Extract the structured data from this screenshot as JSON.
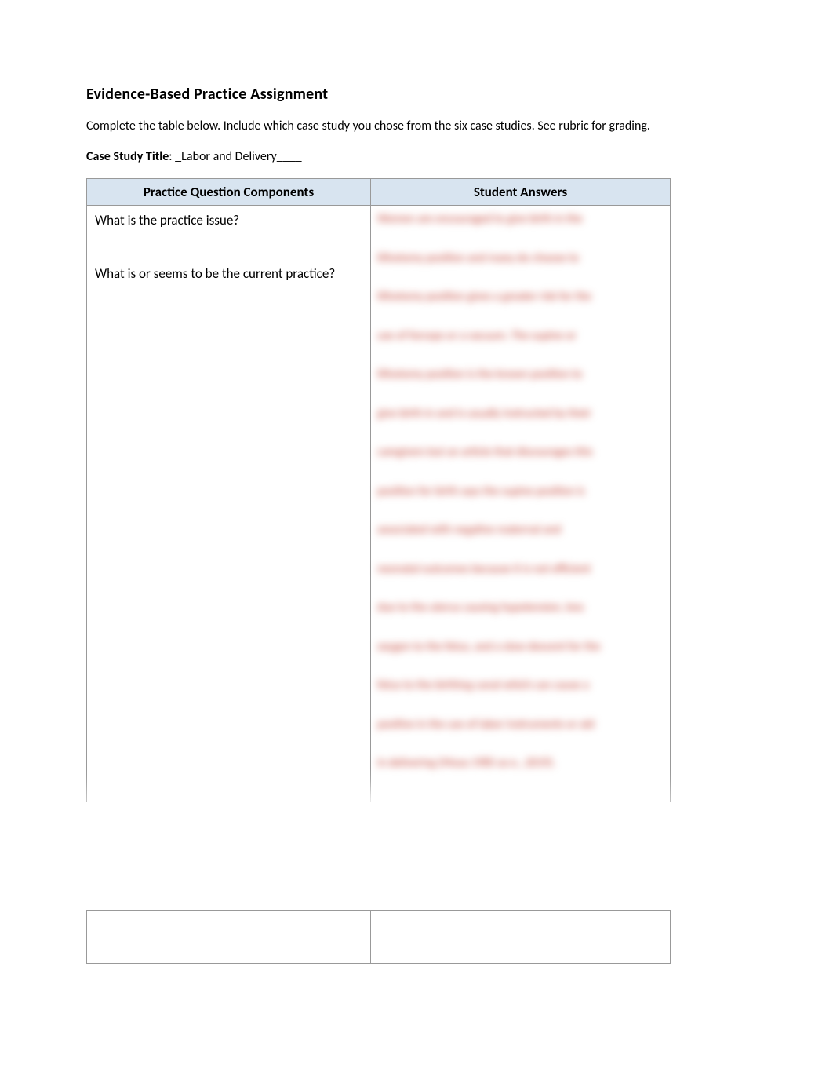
{
  "title": "Evidence-Based Practice Assignment",
  "intro": "Complete the table below. Include which case study you chose from the six case studies. See rubric for grading.",
  "case": {
    "label": "Case Study Title",
    "value": ": _Labor and Delivery____"
  },
  "table": {
    "headers": {
      "left": "Practice Question Components",
      "right": "Student Answers"
    },
    "questions": {
      "q1": "What is the practice issue?",
      "q2": "What is or seems to be the current practice?"
    },
    "blurred_lines": [
      "Women are encouraged to give birth in the",
      "lithotomy position and many do choose to",
      "lithotomy position gives a greater risk for the",
      "use of forceps or a vacuum. The supine or",
      "lithotomy position is the known position to",
      "give birth in and is usually instructed by their",
      "caregivers but an article that discourages this",
      "position for birth says the supine position is",
      "associated with negative maternal and",
      "neonatal outcomes because it is not efficient",
      "due to the uterus causing hypotension, less",
      "oxygen to the fetus, and a slow descent for the",
      "fetus to the birthing canal which can cause a",
      "positive in the use of labor instruments or aid",
      "in delivering (Musa 1985 as e., 2019)."
    ]
  }
}
